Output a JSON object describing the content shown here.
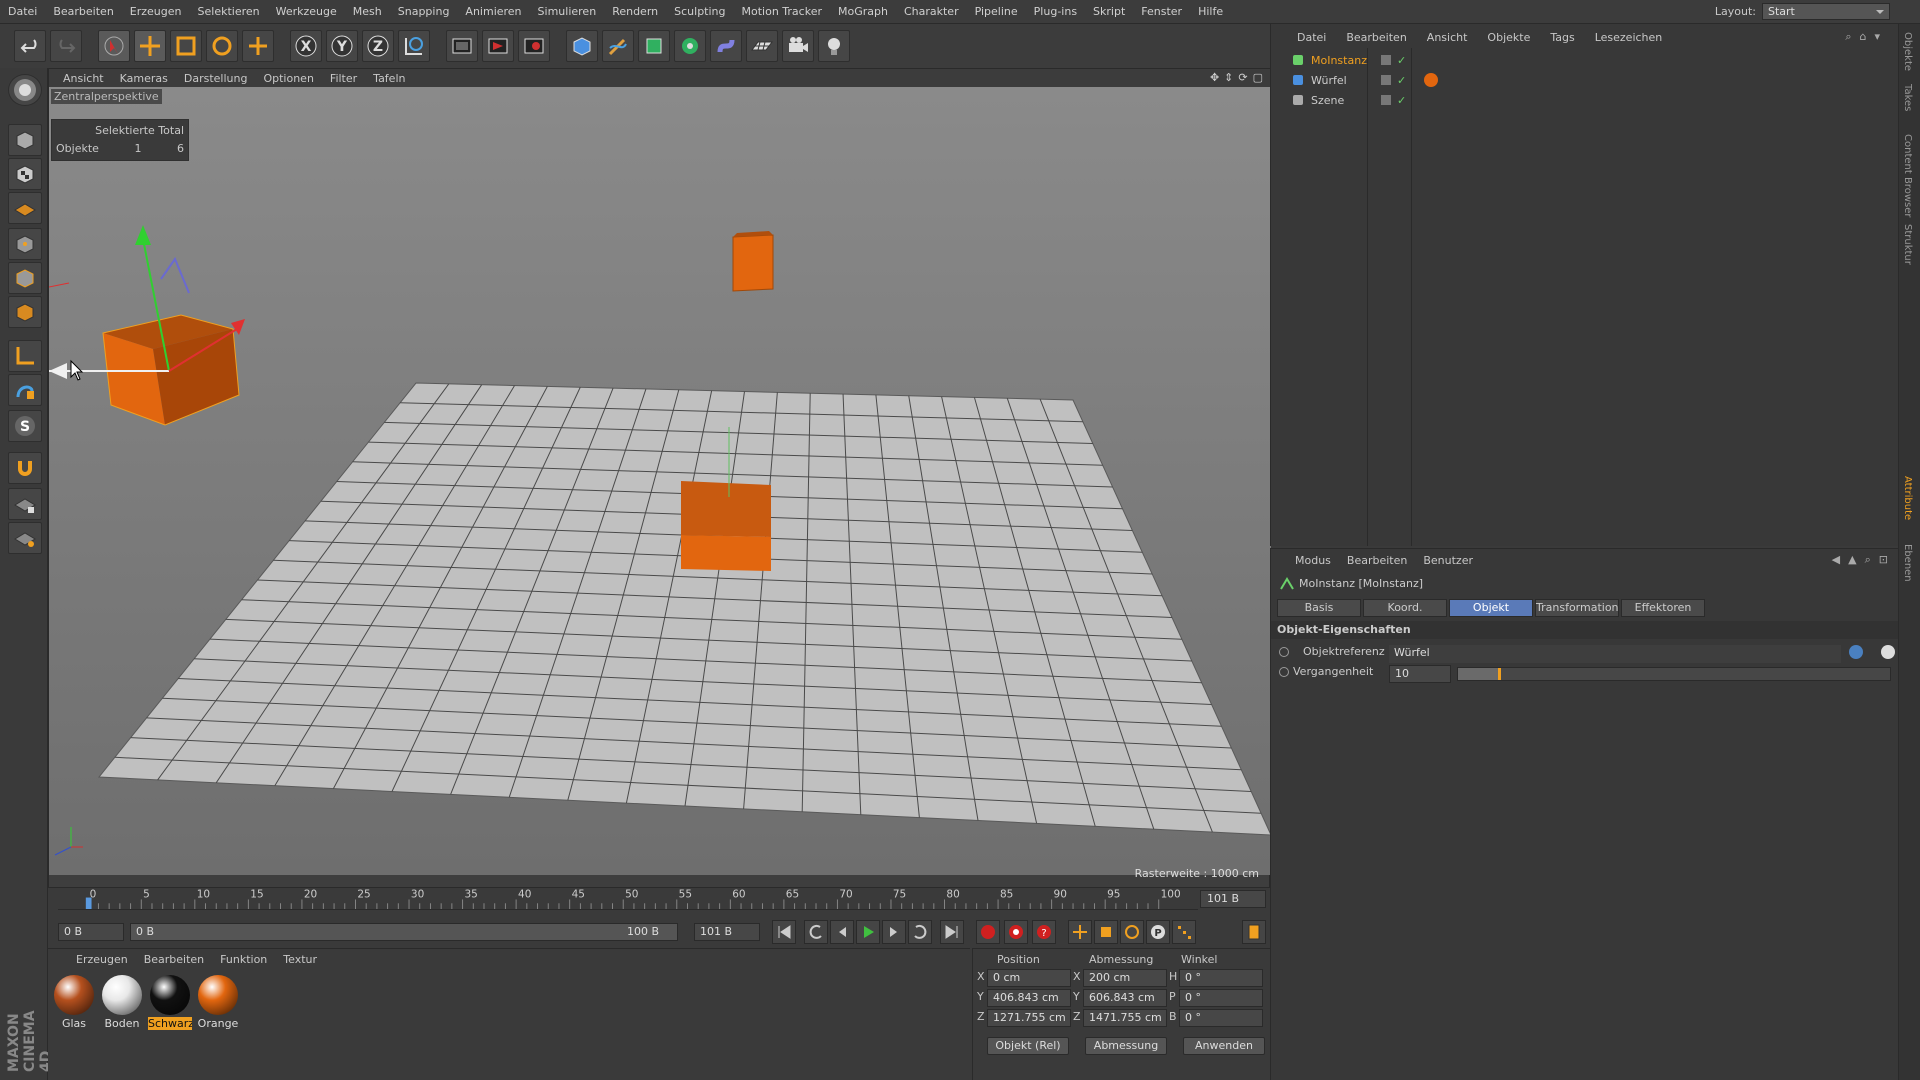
{
  "menubar": {
    "items": [
      "Datei",
      "Bearbeiten",
      "Erzeugen",
      "Selektieren",
      "Werkzeuge",
      "Mesh",
      "Snapping",
      "Animieren",
      "Simulieren",
      "Rendern",
      "Sculpting",
      "Motion Tracker",
      "MoGraph",
      "Charakter",
      "Pipeline",
      "Plug-ins",
      "Skript",
      "Fenster",
      "Hilfe"
    ],
    "layout_label": "Layout:",
    "layout_value": "Start"
  },
  "toolbar": {
    "icons": [
      "undo-icon",
      "redo-icon",
      "select-icon",
      "move-icon",
      "scale-icon",
      "rotate-icon",
      "add-icon",
      "x-axis-icon",
      "y-axis-icon",
      "z-axis-icon",
      "world-coord-icon",
      "render-view-icon",
      "render-picture-icon",
      "render-settings-icon",
      "cube-icon",
      "pen-icon",
      "subdivision-icon",
      "cloner-icon",
      "deformer-icon",
      "floor-icon",
      "camera-icon",
      "light-icon"
    ]
  },
  "viewport": {
    "menu": [
      "Ansicht",
      "Kameras",
      "Darstellung",
      "Optionen",
      "Filter",
      "Tafeln"
    ],
    "label": "Zentralperspektive",
    "hud": {
      "header": "Selektierte Total",
      "row_label": "Objekte",
      "selected": "1",
      "total": "6"
    },
    "raster": "Rasterweite : 1000 cm"
  },
  "timeline": {
    "ticks": [
      "0",
      "5",
      "10",
      "15",
      "20",
      "25",
      "30",
      "35",
      "40",
      "45",
      "50",
      "55",
      "60",
      "65",
      "70",
      "75",
      "80",
      "85",
      "90",
      "95",
      "100"
    ],
    "end_frame": "101 B",
    "current": "0 B",
    "range_start": "0 B",
    "range_end": "100 B",
    "max": "101 B"
  },
  "materials": {
    "menu": [
      "Erzeugen",
      "Bearbeiten",
      "Funktion",
      "Textur"
    ],
    "items": [
      {
        "name": "Glas",
        "color": "#b5501e",
        "selected": false
      },
      {
        "name": "Boden",
        "color": "#e8e8e8",
        "selected": false
      },
      {
        "name": "Schwarz",
        "color": "#111111",
        "selected": true
      },
      {
        "name": "Orange",
        "color": "#e2660f",
        "selected": false
      }
    ]
  },
  "coords": {
    "headers": [
      "Position",
      "Abmessung",
      "Winkel"
    ],
    "rows": [
      {
        "axis": "X",
        "pos": "0 cm",
        "dim_axis": "X",
        "dim": "200 cm",
        "ang_axis": "H",
        "ang": "0 °"
      },
      {
        "axis": "Y",
        "pos": "406.843 cm",
        "dim_axis": "Y",
        "dim": "606.843 cm",
        "ang_axis": "P",
        "ang": "0 °"
      },
      {
        "axis": "Z",
        "pos": "1271.755 cm",
        "dim_axis": "Z",
        "dim": "1471.755 cm",
        "ang_axis": "B",
        "ang": "0 °"
      }
    ],
    "mode": "Objekt (Rel)",
    "size_mode": "Abmessung",
    "apply": "Anwenden"
  },
  "objects": {
    "menu": [
      "Datei",
      "Bearbeiten",
      "Ansicht",
      "Objekte",
      "Tags",
      "Lesezeichen"
    ],
    "items": [
      {
        "name": "MoInstanz",
        "active": true
      },
      {
        "name": "Würfel",
        "active": false
      },
      {
        "name": "Szene",
        "active": false
      }
    ]
  },
  "attributes": {
    "menu": [
      "Modus",
      "Bearbeiten",
      "Benutzer"
    ],
    "title": "MoInstanz [MoInstanz]",
    "tabs": [
      "Basis",
      "Koord.",
      "Objekt",
      "Transformation",
      "Effektoren"
    ],
    "active_tab": "Objekt",
    "section": "Objekt-Eigenschaften",
    "fields": [
      {
        "label": "Objektreferenz",
        "value": "Würfel"
      },
      {
        "label": "Vergangenheit",
        "value": "10"
      }
    ],
    "slider_fraction": 0.1
  },
  "sidetabs": [
    "Objekte",
    "Takes",
    "Content Browser",
    "Struktur",
    "Attribute",
    "Ebenen"
  ],
  "brand": "MAXON CINEMA 4D",
  "colors": {
    "accent": "#f0a020",
    "active_tab": "#5a7ab8",
    "cube_orange": "#e2660f"
  }
}
